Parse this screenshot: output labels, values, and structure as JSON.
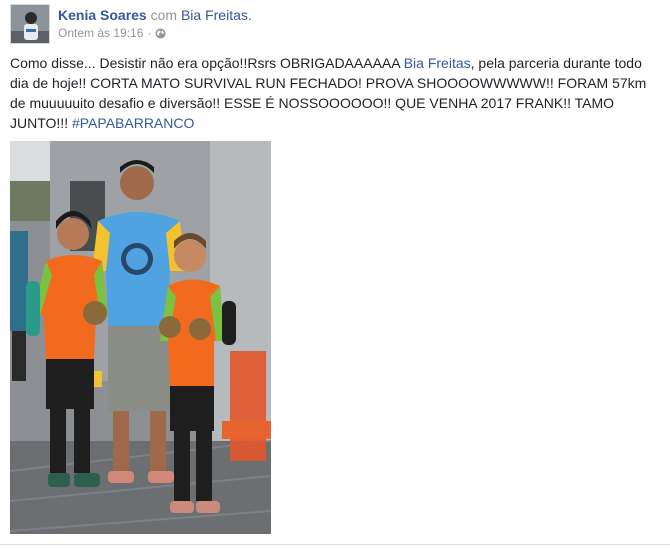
{
  "post": {
    "author": "Kenia Soares",
    "with_word": "com",
    "tagged": "Bia Freitas.",
    "timestamp": "Ontem às 19:16",
    "separator": "·",
    "privacy_icon": "globe-icon",
    "text": {
      "part1": "Como disse... Desistir não era opção!!Rsrs OBRIGADAAAAAA ",
      "mention": "Bia Freitas",
      "part2": ", pela parceria durante todo dia de hoje!! CORTA MATO SURVIVAL RUN FECHADO! PROVA SHOOOOWWWWW!! FORAM 57km de muuuuuito desafio e diversão!! ESSE É NOSSOOOOOO!! QUE VENHA 2017 FRANK!! TAMO JUNTO!!! ",
      "hashtag": "#PAPABARRANCO"
    }
  },
  "colors": {
    "link": "#365899",
    "meta": "#90949c",
    "text": "#1d2129",
    "orange_shirt": "#f26a1e",
    "blue_shirt": "#4fa3e0",
    "green_trim": "#7cc242"
  }
}
